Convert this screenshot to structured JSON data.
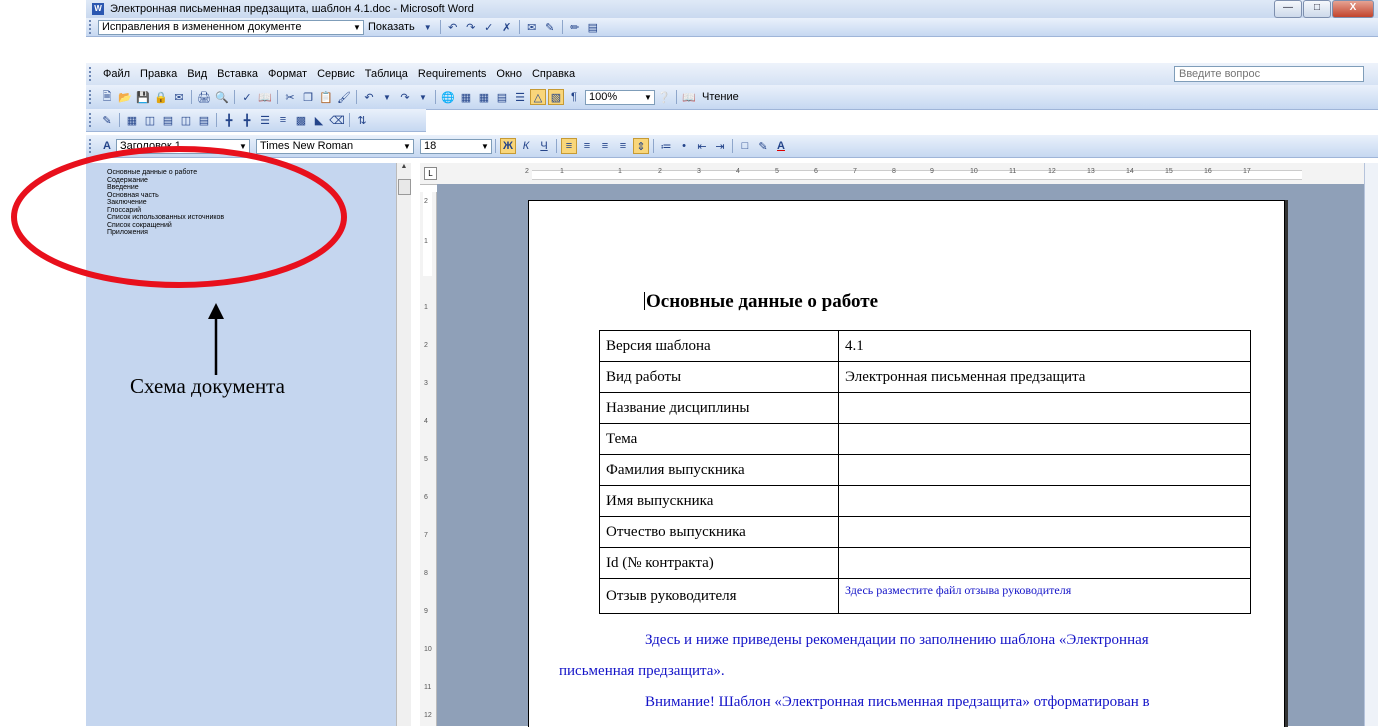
{
  "window": {
    "title": "Электронная письменная предзащита, шаблон 4.1.doc - Microsoft Word",
    "app_icon_label": "W"
  },
  "review_toolbar": {
    "display_mode": "Исправления в измененном документе",
    "show_label": "Показать"
  },
  "menu": {
    "items": [
      "Файл",
      "Правка",
      "Вид",
      "Вставка",
      "Формат",
      "Сервис",
      "Таблица",
      "Requirements",
      "Окно",
      "Справка"
    ],
    "help_placeholder": "Введите вопрос"
  },
  "standard_toolbar": {
    "zoom": "100%",
    "reading_label": "Чтение"
  },
  "format_toolbar": {
    "style": "Заголовок 1",
    "font": "Times New Roman",
    "size": "18"
  },
  "doc_map": {
    "items": [
      "Основные данные о работе",
      "Содержание",
      "Введение",
      "Основная часть",
      "Заключение",
      "Глоссарий",
      "Список использованных источников",
      "Список сокращений",
      "Приложения"
    ]
  },
  "annotation": {
    "label": "Схема документа",
    "color": "#e8101c"
  },
  "ruler": {
    "h_ticks": [
      "2",
      "1",
      "1",
      "2",
      "3",
      "4",
      "5",
      "6",
      "7",
      "8",
      "9",
      "10",
      "11",
      "12",
      "13",
      "14",
      "15",
      "16",
      "17"
    ],
    "v_ticks": [
      "2",
      "1",
      "1",
      "2",
      "3",
      "4",
      "5",
      "6",
      "7",
      "8",
      "9",
      "10",
      "11",
      "12"
    ]
  },
  "document": {
    "heading": "Основные данные о работе",
    "table": [
      {
        "label": "Версия шаблона",
        "value": "4.1"
      },
      {
        "label": "Вид работы",
        "value": "Электронная письменная предзащита"
      },
      {
        "label": "Название дисциплины",
        "value": ""
      },
      {
        "label": "Тема",
        "value": ""
      },
      {
        "label": "Фамилия выпускника",
        "value": ""
      },
      {
        "label": "Имя выпускника",
        "value": ""
      },
      {
        "label": "Отчество выпускника",
        "value": ""
      },
      {
        "label": "Id (№ контракта)",
        "value": ""
      },
      {
        "label": "Отзыв руководителя",
        "value": "Здесь разместите файл отзыва руководителя"
      }
    ],
    "para1_line1": "Здесь и ниже приведены рекомендации по заполнению шаблона «Электронная",
    "para1_line2": "письменная предзащита».",
    "para2_line1": "Внимание! Шаблон «Электронная письменная предзащита» отформатирован в"
  }
}
